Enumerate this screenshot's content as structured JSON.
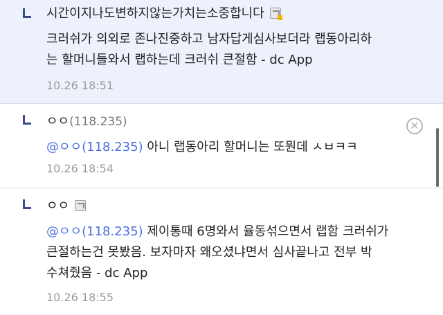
{
  "replies": [
    {
      "nickname": "시간이지나도변하지않는가치는소중합니다",
      "ip": "",
      "text_lines": [
        "크러쉬가 의외로 존나진중하고 남자답게심사보더라 랩동아리하",
        "는 할머니들와서 랩하는데 크러쉬 큰절함 - dc App"
      ],
      "mention": "",
      "timestamp": "10.26 18:51"
    },
    {
      "nickname": "ㅇㅇ",
      "ip": "(118.235)",
      "mention": "@ㅇㅇ(118.235)",
      "text_lines": [
        " 아니 랩동아리 할머니는 또뭔데 ㅅㅂㅋㅋ"
      ],
      "timestamp": "10.26 18:54",
      "delete_icon": "close-circle-icon"
    },
    {
      "nickname": "ㅇㅇ",
      "ip": "",
      "mention": "@ㅇㅇ(118.235)",
      "text_lines": [
        " 제이통때 6명와서 율동섞으면서 랩함 크러쉬가",
        "큰절하는건 못봤음. 보자마자 왜오셨냐면서 심사끝나고 전부 박",
        "수쳐줬음 - dc App"
      ],
      "timestamp": "10.26 18:55"
    }
  ],
  "colors": {
    "highlight_bg": "#edf1fb",
    "mention": "#4a6ee0",
    "timestamp": "#9a9a9a",
    "reply_marker": "#3b4a8a"
  }
}
